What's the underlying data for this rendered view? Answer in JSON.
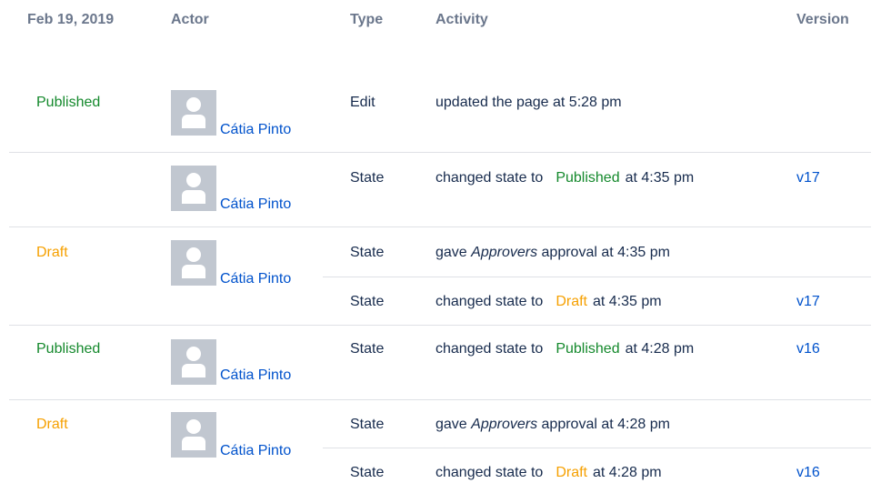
{
  "header": {
    "date": "Feb 19, 2019",
    "actor": "Actor",
    "type": "Type",
    "activity": "Activity",
    "version": "Version"
  },
  "groups": [
    {
      "state": "Published",
      "actor": "Cátia Pinto",
      "rows": [
        {
          "type": "Edit",
          "activity": "updated the page at 5:28 pm",
          "version": ""
        }
      ]
    },
    {
      "state": "",
      "actor": "Cátia Pinto",
      "rows": [
        {
          "type": "State",
          "prefix": "changed state to",
          "state": "Published",
          "suffix": "at 4:35 pm",
          "version": "v17"
        }
      ]
    },
    {
      "state": "Draft",
      "actor": "Cátia Pinto",
      "rows": [
        {
          "type": "State",
          "prefix": "gave",
          "em": "Approvers",
          "suffix": "approval at 4:35 pm",
          "version": ""
        },
        {
          "type": "State",
          "prefix": "changed state to",
          "state": "Draft",
          "suffix": "at 4:35 pm",
          "version": "v17"
        }
      ]
    },
    {
      "state": "Published",
      "actor": "Cátia Pinto",
      "rows": [
        {
          "type": "State",
          "prefix": "changed state to",
          "state": "Published",
          "suffix": "at 4:28 pm",
          "version": "v16"
        }
      ]
    },
    {
      "state": "Draft",
      "actor": "Cátia Pinto",
      "rows": [
        {
          "type": "State",
          "prefix": "gave",
          "em": "Approvers",
          "suffix": "approval at 4:28 pm",
          "version": ""
        },
        {
          "type": "State",
          "prefix": "changed state to",
          "state": "Draft",
          "suffix": "at 4:28 pm",
          "version": "v16"
        }
      ]
    }
  ],
  "colors": {
    "published": "#14892c",
    "draft": "#f6a000",
    "link": "#0052cc",
    "header": "#6b778c"
  },
  "icons": {
    "avatar": "default-user-avatar-icon"
  }
}
